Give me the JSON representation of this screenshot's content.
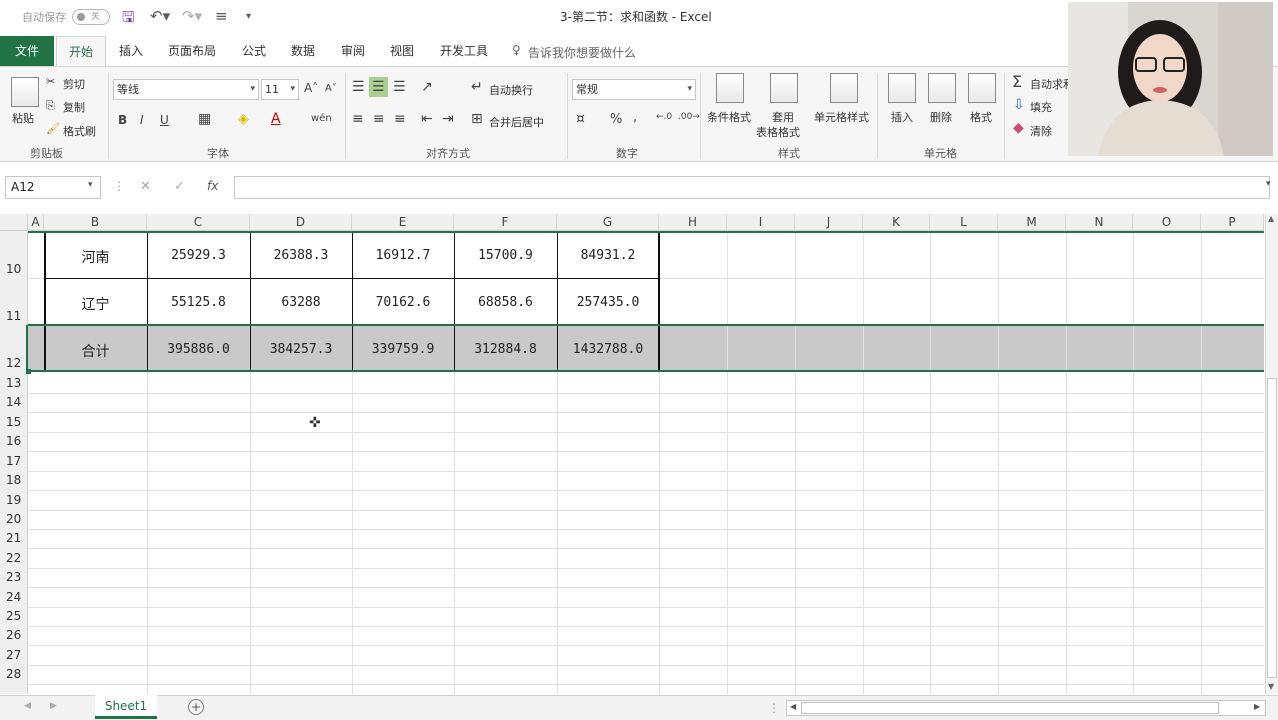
{
  "titlebar": {
    "autosave_label": "自动保存",
    "autosave_state": "关",
    "document_title": "3-第二节：求和函数  -  Excel"
  },
  "tabs": [
    {
      "label": "文件"
    },
    {
      "label": "开始"
    },
    {
      "label": "插入"
    },
    {
      "label": "页面布局"
    },
    {
      "label": "公式"
    },
    {
      "label": "数据"
    },
    {
      "label": "审阅"
    },
    {
      "label": "视图"
    },
    {
      "label": "开发工具"
    }
  ],
  "tell_me": "告诉我你想要做什么",
  "ribbon": {
    "clipboard": {
      "paste": "粘贴",
      "cut": "剪切",
      "copy": "复制",
      "format_painter": "格式刷",
      "label": "剪贴板"
    },
    "font": {
      "name": "等线",
      "size": "11",
      "bold": "B",
      "italic": "I",
      "underline": "U",
      "phonetic": "wén",
      "label": "字体"
    },
    "alignment": {
      "wrap": "自动换行",
      "merge": "合并后居中",
      "label": "对齐方式"
    },
    "number": {
      "format": "常规",
      "percent": "%",
      "comma": ",",
      "label": "数字"
    },
    "styles": {
      "conditional": "条件格式",
      "table1": "套用",
      "table2": "表格格式",
      "cell_styles": "单元格样式",
      "label": "样式"
    },
    "cells": {
      "insert": "插入",
      "delete": "删除",
      "format": "格式",
      "label": "单元格"
    },
    "editing": {
      "autosum": "自动求和",
      "fill": "填充",
      "clear": "清除"
    }
  },
  "formula_bar": {
    "name_box": "A12",
    "fx": "fx",
    "cancel": "✕",
    "enter": "✓",
    "value": ""
  },
  "columns": [
    "A",
    "B",
    "C",
    "D",
    "E",
    "F",
    "G",
    "H",
    "I",
    "J",
    "K",
    "L",
    "M",
    "N",
    "O",
    "P"
  ],
  "rows": {
    "r10": {
      "num": "10",
      "cells": [
        "河南",
        "25929.3",
        "26388.3",
        "16912.7",
        "15700.9",
        "84931.2"
      ]
    },
    "r11": {
      "num": "11",
      "cells": [
        "辽宁",
        "55125.8",
        "63288",
        "70162.6",
        "68858.6",
        "257435.0"
      ]
    },
    "r12": {
      "num": "12",
      "cells": [
        "合计",
        "395886.0",
        "384257.3",
        "339759.9",
        "312884.8",
        "1432788.0"
      ]
    },
    "empty_rows": [
      "13",
      "14",
      "15",
      "16",
      "17",
      "18",
      "19",
      "20",
      "21",
      "22",
      "23",
      "24",
      "25",
      "26",
      "27",
      "28"
    ]
  },
  "sheet_tab": "Sheet1",
  "colors": {
    "excel_green": "#217346",
    "selection_fill": "#c9c9c9"
  }
}
